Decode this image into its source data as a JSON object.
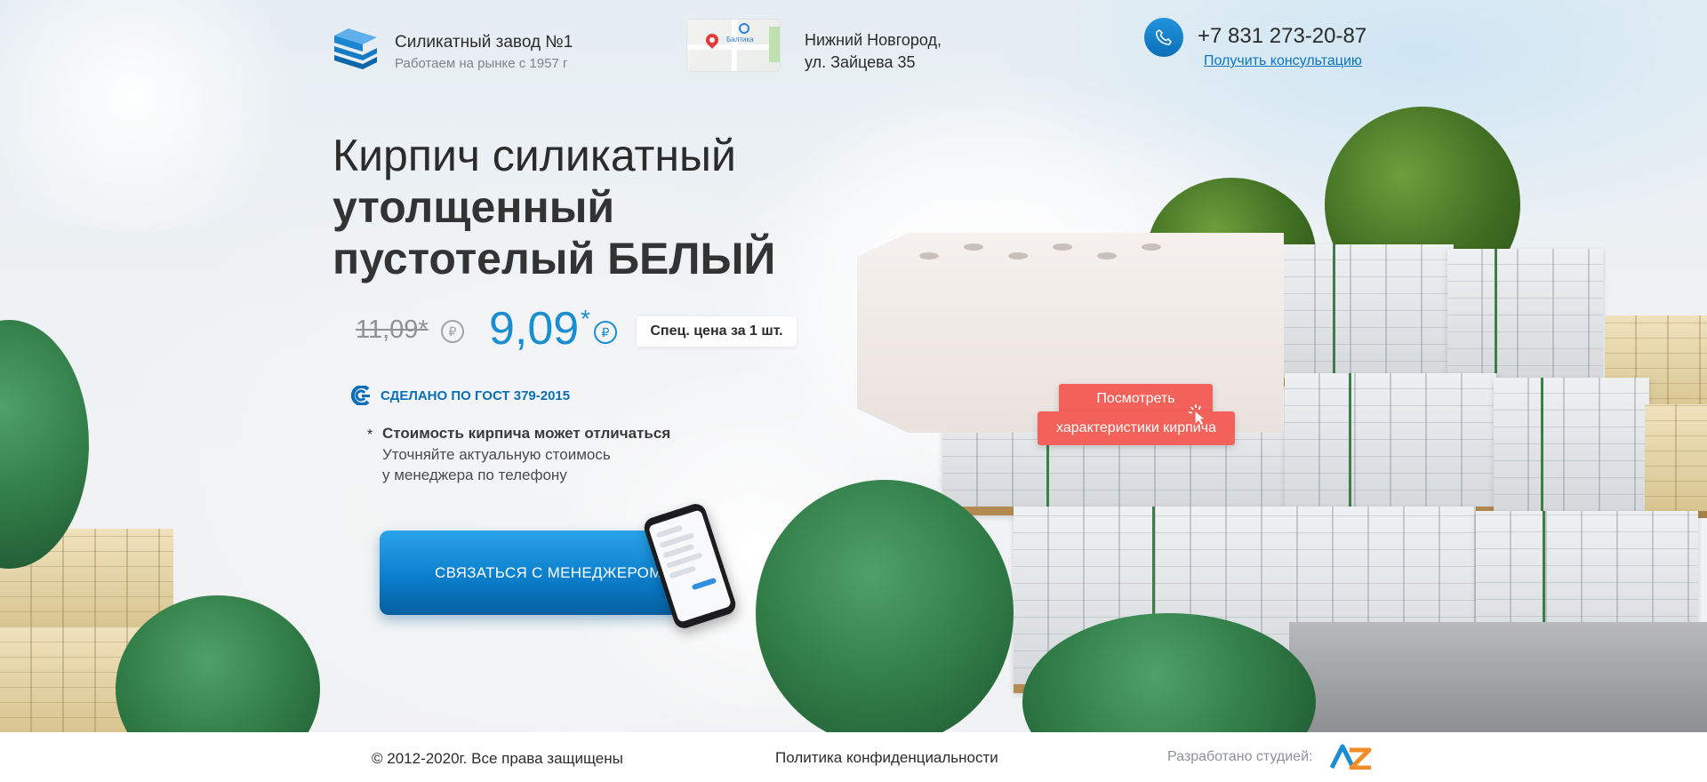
{
  "header": {
    "brand_name": "Силикатный завод №1",
    "brand_sub": "Работаем на рынке с 1957 г",
    "map_label": "Балтика",
    "address_line1": "Нижний Новгород,",
    "address_line2": "ул. Зайцева 35",
    "phone": "+7 831 273-20-87",
    "consult_link": "Получить консультацию"
  },
  "hero": {
    "title_line1": "Кирпич силикатный",
    "title_line2": "утолщенный",
    "title_line3": "пустотелый БЕЛЫЙ",
    "old_price": "11,09*",
    "new_price": "9,09",
    "new_price_star": "*",
    "currency_symbol": "₽",
    "price_badge": "Спец. цена за 1 шт.",
    "gost": "СДЕЛАНО ПО ГОСТ 379-2015",
    "note_star": "*",
    "note_head": "Стоимость кирпича может отличаться",
    "note_line2": "Уточняйте актуальную стоимось",
    "note_line3": "у менеджера по телефону",
    "cta_label": "СВЯЗАТЬСЯ С МЕНЕДЖЕРОМ",
    "view_label": "Посмотреть",
    "specs_label": "характеристики кирпича"
  },
  "footer": {
    "copyright": "© 2012-2020г. Все права защищены",
    "privacy": "Политика конфиденциальности",
    "dev_label": "Разработано студией:"
  },
  "colors": {
    "accent_blue": "#1b8dd1",
    "cta_red": "#f3625a",
    "text_dark": "#2b2b2b"
  },
  "icons": {
    "logo": "company-logo-icon",
    "phone": "phone-icon",
    "gost": "gost-icon",
    "cursor": "cursor-click-icon",
    "dev": "studio-logo-icon"
  }
}
